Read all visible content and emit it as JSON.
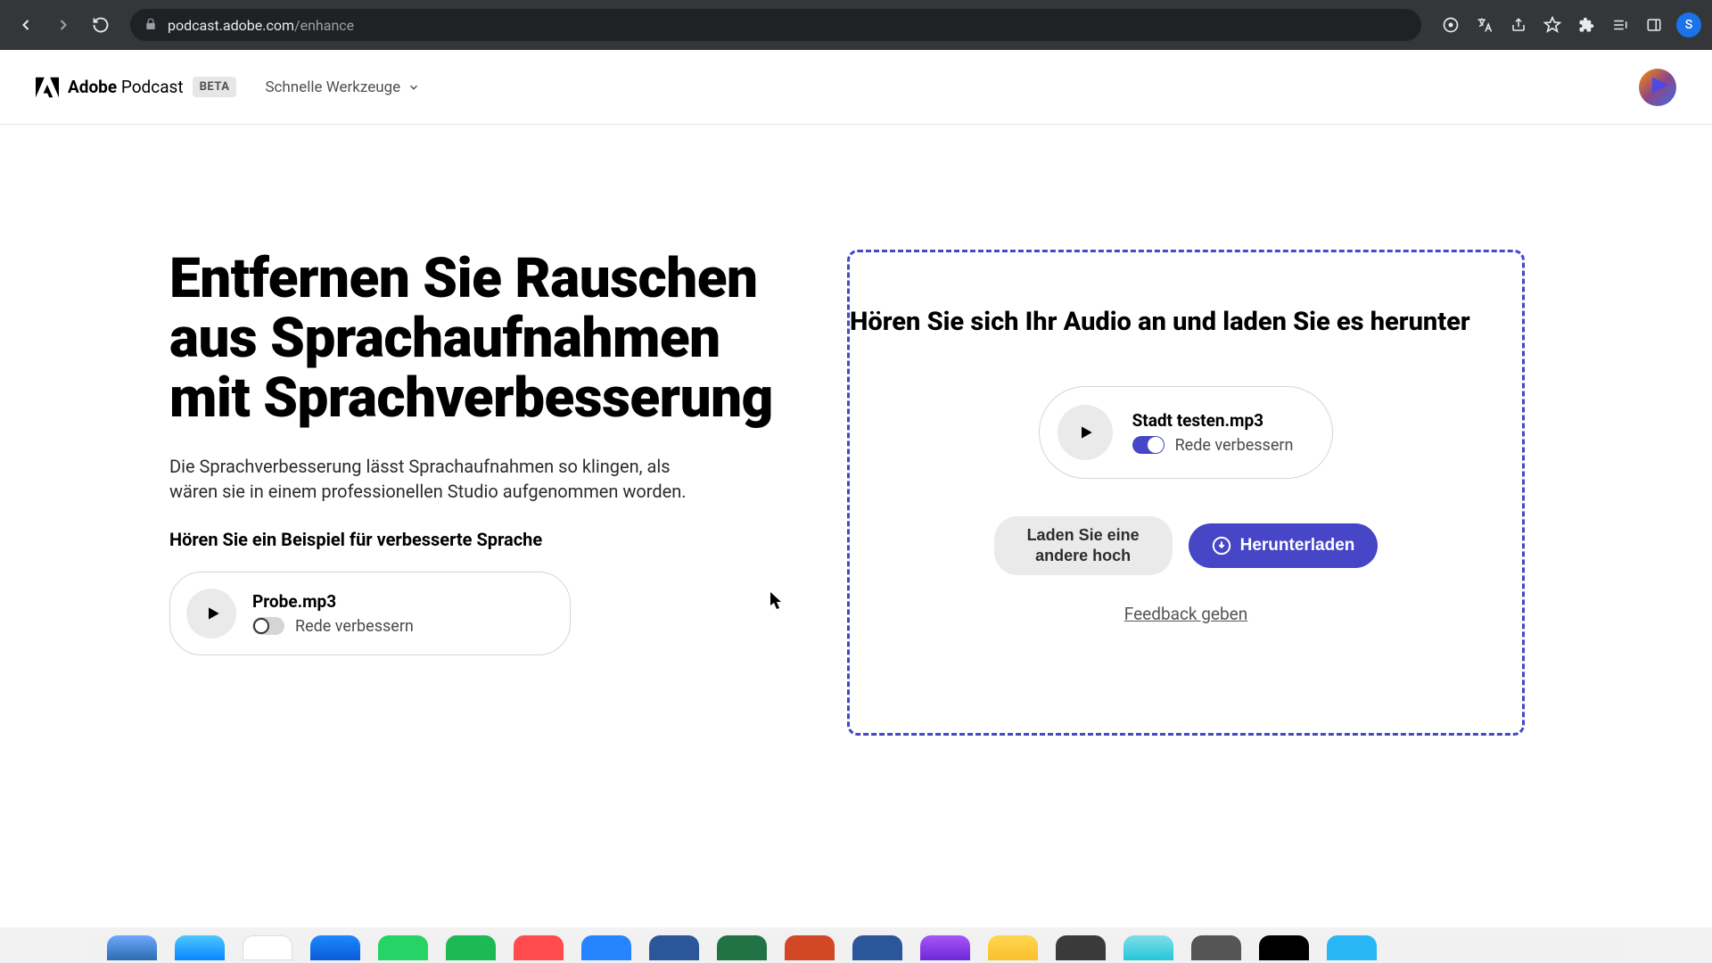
{
  "browser": {
    "url_host": "podcast.adobe.com",
    "url_path": "/enhance",
    "profile_initial": "S"
  },
  "header": {
    "logo_bold": "Adobe",
    "logo_light": " Podcast",
    "beta": "BETA",
    "nav_dropdown": "Schnelle Werkzeuge"
  },
  "main": {
    "heading": "Entfernen Sie Rauschen aus Sprachaufnahmen mit Sprachverbesserung",
    "description": "Die Sprachverbesserung lässt Sprachaufnahmen so klingen, als wären sie in einem professionellen Studio aufgenommen worden.",
    "example_heading": "Hören Sie ein Beispiel für verbesserte Sprache",
    "sample": {
      "filename": "Probe.mp3",
      "toggle_label": "Rede verbessern"
    }
  },
  "panel": {
    "heading": "Hören Sie sich Ihr Audio an und laden Sie es herunter",
    "result": {
      "filename": "Stadt testen.mp3",
      "toggle_label": "Rede verbessern"
    },
    "upload_another": "Laden Sie eine andere hoch",
    "download": "Herunterladen",
    "feedback": "Feedback geben"
  },
  "colors": {
    "accent": "#4646c6"
  }
}
